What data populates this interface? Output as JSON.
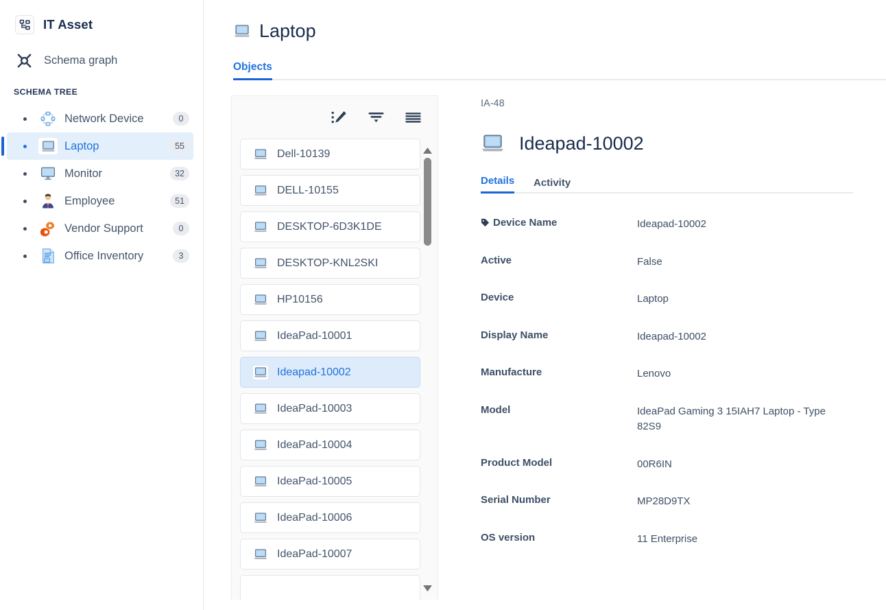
{
  "sidebar": {
    "brand": {
      "title": "IT Asset",
      "icon": "hierarchy-icon"
    },
    "schema_graph": {
      "label": "Schema graph",
      "icon": "graph-node-icon"
    },
    "section_title": "SCHEMA TREE",
    "items": [
      {
        "label": "Network Device",
        "count": "0",
        "icon": "network-device-icon",
        "selected": false
      },
      {
        "label": "Laptop",
        "count": "55",
        "icon": "laptop-icon",
        "selected": true
      },
      {
        "label": "Monitor",
        "count": "32",
        "icon": "monitor-icon",
        "selected": false
      },
      {
        "label": "Employee",
        "count": "51",
        "icon": "employee-icon",
        "selected": false
      },
      {
        "label": "Vendor Support",
        "count": "0",
        "icon": "gears-icon",
        "selected": false
      },
      {
        "label": "Office Inventory",
        "count": "3",
        "icon": "document-icon",
        "selected": false
      }
    ]
  },
  "page": {
    "title": "Laptop",
    "icon": "laptop-icon",
    "tabs": [
      {
        "label": "Objects",
        "active": true
      }
    ]
  },
  "object_list": {
    "toolbar": [
      {
        "name": "edit-attributes-icon",
        "label": "Edit attributes"
      },
      {
        "name": "filter-icon",
        "label": "Filter"
      },
      {
        "name": "list-view-icon",
        "label": "List view"
      }
    ],
    "items": [
      {
        "label": "Dell-10139",
        "selected": false
      },
      {
        "label": "DELL-10155",
        "selected": false
      },
      {
        "label": "DESKTOP-6D3K1DE",
        "selected": false
      },
      {
        "label": "DESKTOP-KNL2SKI",
        "selected": false
      },
      {
        "label": "HP10156",
        "selected": false
      },
      {
        "label": "IdeaPad-10001",
        "selected": false
      },
      {
        "label": "Ideapad-10002",
        "selected": true
      },
      {
        "label": "IdeaPad-10003",
        "selected": false
      },
      {
        "label": "IdeaPad-10004",
        "selected": false
      },
      {
        "label": "IdeaPad-10005",
        "selected": false
      },
      {
        "label": "IdeaPad-10006",
        "selected": false
      },
      {
        "label": "IdeaPad-10007",
        "selected": false
      },
      {
        "label": "",
        "selected": false
      }
    ]
  },
  "detail": {
    "key": "IA-48",
    "title": "Ideapad-10002",
    "icon": "laptop-icon",
    "tabs": [
      {
        "label": "Details",
        "active": true
      },
      {
        "label": "Activity",
        "active": false
      }
    ],
    "fields": [
      {
        "label": "Device Name",
        "value": "Ideapad-10002",
        "icon": "tag-icon"
      },
      {
        "label": "Active",
        "value": "False"
      },
      {
        "label": "Device",
        "value": "Laptop"
      },
      {
        "label": "Display Name",
        "value": "Ideapad-10002"
      },
      {
        "label": "Manufacture",
        "value": "Lenovo"
      },
      {
        "label": "Model",
        "value": "IdeaPad Gaming 3 15IAH7 Laptop - Type 82S9"
      },
      {
        "label": "Product Model",
        "value": "00R6IN"
      },
      {
        "label": "Serial Number",
        "value": "MP28D9TX"
      },
      {
        "label": "OS version",
        "value": "11 Enterprise"
      }
    ]
  },
  "colors": {
    "accent": "#2072e0",
    "accent_bar": "#1b62d4",
    "selected_bg": "#e4effc",
    "list_selected_bg": "#ddebfa",
    "text": "#44546b",
    "heading": "#172b4d",
    "badge_bg": "#ebecf0"
  }
}
